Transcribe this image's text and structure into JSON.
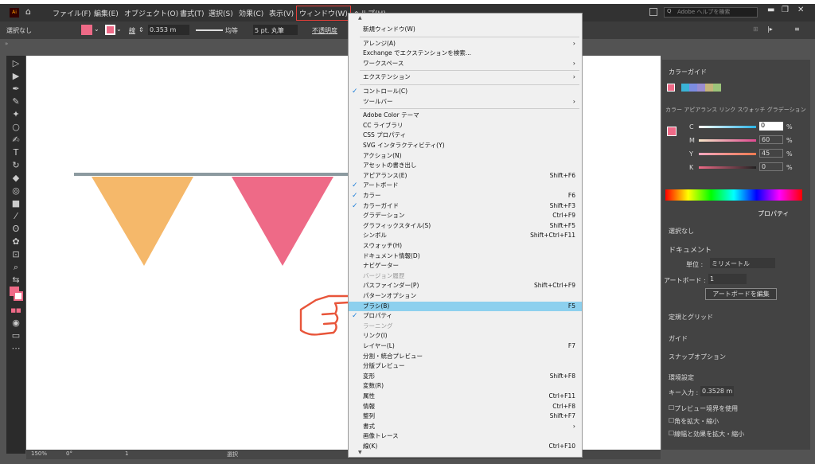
{
  "menubar": {
    "app_icon": "Ai",
    "items": [
      "ファイル(F)",
      "編集(E)",
      "オブジェクト(O)",
      "書式(T)",
      "選択(S)",
      "効果(C)",
      "表示(V)",
      "ウィンドウ(W)",
      "ヘルプ(H)"
    ],
    "search_placeholder": "Adobe ヘルプを検索"
  },
  "control": {
    "selection": "選択なし",
    "stroke_label": "線",
    "stroke_value": "0.353 m",
    "profile": "均等",
    "brush": "5 pt. 丸筆",
    "opacity_label": "不透明度"
  },
  "menu": {
    "rows": [
      {
        "label": "新規ウィンドウ(W)"
      },
      {
        "sep": true
      },
      {
        "label": "アレンジ(A)",
        "arrow": true
      },
      {
        "label": "Exchange でエクステンションを検索..."
      },
      {
        "label": "ワークスペース",
        "arrow": true
      },
      {
        "sep": true
      },
      {
        "label": "エクステンション",
        "arrow": true
      },
      {
        "sep": true
      },
      {
        "label": "コントロール(C)",
        "check": true
      },
      {
        "label": "ツールバー",
        "arrow": true
      },
      {
        "sep": true
      },
      {
        "label": "Adobe Color テーマ"
      },
      {
        "label": "CC ライブラリ"
      },
      {
        "label": "CSS プロパティ"
      },
      {
        "label": "SVG インタラクティビティ(Y)"
      },
      {
        "label": "アクション(N)"
      },
      {
        "label": "アセットの書き出し"
      },
      {
        "label": "アピアランス(E)",
        "shortcut": "Shift+F6"
      },
      {
        "label": "アートボード",
        "check": true
      },
      {
        "label": "カラー",
        "shortcut": "F6",
        "check": true
      },
      {
        "label": "カラーガイド",
        "shortcut": "Shift+F3",
        "check": true
      },
      {
        "label": "グラデーション",
        "shortcut": "Ctrl+F9"
      },
      {
        "label": "グラフィックスタイル(S)",
        "shortcut": "Shift+F5"
      },
      {
        "label": "シンボル",
        "shortcut": "Shift+Ctrl+F11"
      },
      {
        "label": "スウォッチ(H)"
      },
      {
        "label": "ドキュメント情報(D)"
      },
      {
        "label": "ナビゲーター"
      },
      {
        "label": "バージョン履歴",
        "disabled": true
      },
      {
        "label": "パスファインダー(P)",
        "shortcut": "Shift+Ctrl+F9"
      },
      {
        "label": "パターンオプション"
      },
      {
        "label": "ブラシ(B)",
        "shortcut": "F5",
        "highlight": true
      },
      {
        "label": "プロパティ",
        "check": true
      },
      {
        "label": "ラーニング",
        "disabled": true
      },
      {
        "label": "リンク(I)"
      },
      {
        "label": "レイヤー(L)",
        "shortcut": "F7"
      },
      {
        "label": "分割・統合プレビュー"
      },
      {
        "label": "分版プレビュー"
      },
      {
        "label": "変形",
        "shortcut": "Shift+F8"
      },
      {
        "label": "変数(R)"
      },
      {
        "label": "属性",
        "shortcut": "Ctrl+F11"
      },
      {
        "label": "情報",
        "shortcut": "Ctrl+F8"
      },
      {
        "label": "整列",
        "shortcut": "Shift+F7"
      },
      {
        "label": "書式",
        "arrow": true
      },
      {
        "label": "画像トレース"
      },
      {
        "label": "線(K)",
        "shortcut": "Ctrl+F10"
      }
    ]
  },
  "panels": {
    "color_guide_title": "カラーガイド",
    "color_tabs": "カラー  アピアランス  リンク  スウォッチ  グラデーション",
    "cmyk": [
      {
        "label": "C",
        "value": "0",
        "unit": "%"
      },
      {
        "label": "M",
        "value": "60",
        "unit": "%"
      },
      {
        "label": "Y",
        "value": "45",
        "unit": "%"
      },
      {
        "label": "K",
        "value": "0",
        "unit": "%"
      }
    ],
    "prop_tab": "プロパティ",
    "no_selection": "選択なし",
    "document": "ドキュメント",
    "unit_label": "単位 :",
    "unit_value": "ミリメートル",
    "artboard_label": "アートボード :",
    "artboard_value": "1",
    "edit_artboard": "アートボードを編集",
    "ruler_grid": "定規とグリッド",
    "guides": "ガイド",
    "snap": "スナップオプション",
    "prefs": "環境設定",
    "key_label": "キー入力 :",
    "key_value": "0.3528 m",
    "preview_check": "プレビュー境界を使用",
    "scale_corners": "角を拡大・縮小",
    "scale_strokes": "線幅と効果を拡大・縮小"
  },
  "status": {
    "zoom": "150%",
    "rotation": "0°",
    "artboard": "1",
    "mode": "選択"
  },
  "colors": {
    "flag1": "#f5b86a",
    "flag2": "#ee6a87",
    "pointer": "#e8553a"
  }
}
